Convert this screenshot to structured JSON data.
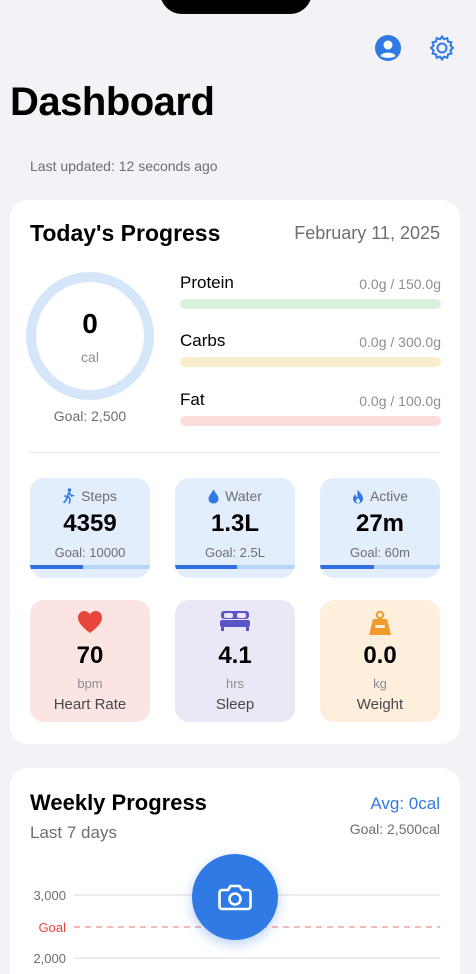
{
  "header": {
    "title": "Dashboard",
    "last_updated": "Last updated: 12 seconds ago",
    "profile_icon": "person-circle-icon",
    "settings_icon": "gear-icon"
  },
  "today": {
    "title": "Today's Progress",
    "date": "February 11, 2025",
    "calories": {
      "value": "0",
      "unit": "cal",
      "goal": "Goal: 2,500"
    },
    "macros": [
      {
        "name": "Protein",
        "amount": "0.0g / 150.0g",
        "progress": 0,
        "color": "#d9f1dd"
      },
      {
        "name": "Carbs",
        "amount": "0.0g / 300.0g",
        "progress": 0,
        "color": "#faedcc"
      },
      {
        "name": "Fat",
        "amount": "0.0g / 100.0g",
        "progress": 0,
        "color": "#fbdedb"
      }
    ],
    "stats": [
      {
        "label": "Steps",
        "icon": "walking-icon",
        "value": "4359",
        "goal": "Goal: 10000",
        "progress": 0.44
      },
      {
        "label": "Water",
        "icon": "water-drop-icon",
        "value": "1.3L",
        "goal": "Goal: 2.5L",
        "progress": 0.52
      },
      {
        "label": "Active",
        "icon": "flame-icon",
        "value": "27m",
        "goal": "Goal: 60m",
        "progress": 0.45
      }
    ],
    "health": [
      {
        "label": "Heart Rate",
        "icon": "heart-icon",
        "value": "70",
        "unit": "bpm",
        "bg": "#fbe4e1",
        "icon_color": "#e8463c"
      },
      {
        "label": "Sleep",
        "icon": "bed-icon",
        "value": "4.1",
        "unit": "hrs",
        "bg": "#eae8f6",
        "icon_color": "#5b55c8"
      },
      {
        "label": "Weight",
        "icon": "weight-icon",
        "value": "0.0",
        "unit": "kg",
        "bg": "#fdefdc",
        "icon_color": "#f09a2e"
      }
    ]
  },
  "weekly": {
    "title": "Weekly Progress",
    "subtitle": "Last 7 days",
    "avg": "Avg: 0cal",
    "goal": "Goal: 2,500cal",
    "goal_line_label": "Goal",
    "y_ticks": [
      "3,000",
      "2,000"
    ]
  },
  "camera_button_icon": "camera-icon",
  "chart_data": {
    "type": "line",
    "title": "Weekly Progress",
    "y_ticks": [
      3000,
      2000
    ],
    "goal_line": 2500,
    "series": []
  },
  "colors": {
    "accent": "#2f7ae5",
    "ring": "#d5e6fb",
    "goal_line": "#e8463c"
  }
}
